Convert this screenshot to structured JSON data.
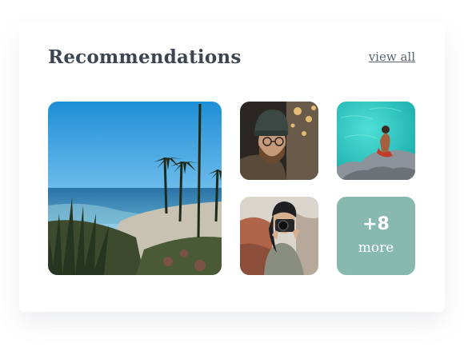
{
  "header": {
    "title": "Recommendations",
    "view_all_label": "view all"
  },
  "gallery": {
    "photos": [
      {
        "icon": "coastal-palms-photo"
      },
      {
        "icon": "man-beanie-portrait-photo"
      },
      {
        "icon": "person-on-rocks-photo"
      },
      {
        "icon": "photographer-camera-photo"
      }
    ],
    "more_tile": {
      "count": "+8",
      "label": "more"
    }
  },
  "colors": {
    "title": "#3d4650",
    "link": "#5a6470",
    "more_tile_bg": "#88b9ae"
  }
}
